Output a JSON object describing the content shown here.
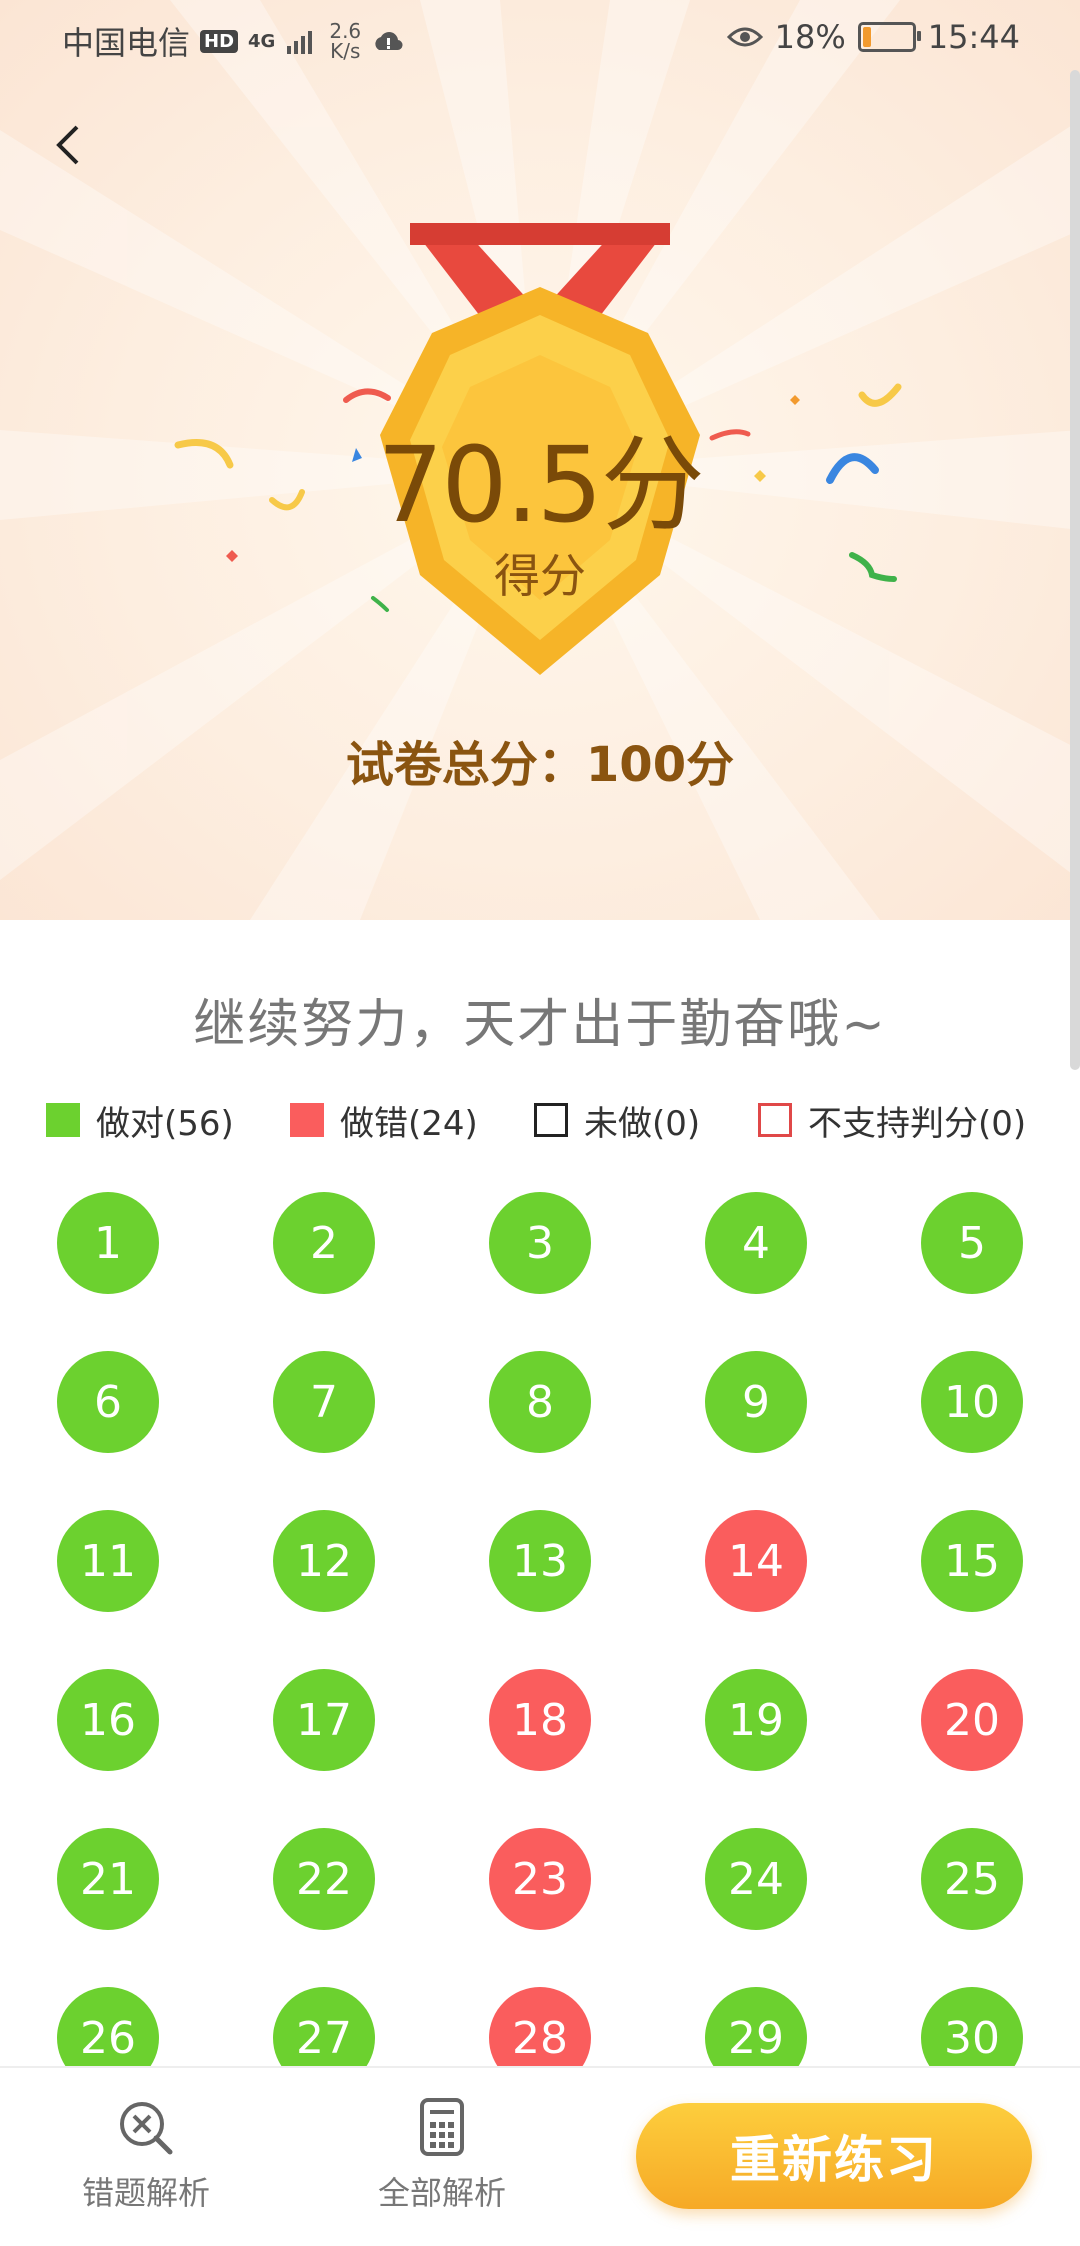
{
  "status_bar": {
    "carrier": "中国电信",
    "hd_badge": "HD",
    "network": "4G",
    "speed_value": "2.6",
    "speed_unit": "K/s",
    "battery_percent": "18%",
    "battery_level": 0.18,
    "time": "15:44"
  },
  "result": {
    "score": "70.5分",
    "score_label": "得分",
    "total": "试卷总分：100分",
    "motto": "继续努力，天才出于勤奋哦~"
  },
  "legend": {
    "correct": "做对(56)",
    "wrong": "做错(24)",
    "undone": "未做(0)",
    "unsupported": "不支持判分(0)"
  },
  "colors": {
    "correct": "#6cd12f",
    "wrong": "#fa5d5d",
    "accent": "#f6a926"
  },
  "questions": [
    {
      "n": "1",
      "s": "correct"
    },
    {
      "n": "2",
      "s": "correct"
    },
    {
      "n": "3",
      "s": "correct"
    },
    {
      "n": "4",
      "s": "correct"
    },
    {
      "n": "5",
      "s": "correct"
    },
    {
      "n": "6",
      "s": "correct"
    },
    {
      "n": "7",
      "s": "correct"
    },
    {
      "n": "8",
      "s": "correct"
    },
    {
      "n": "9",
      "s": "correct"
    },
    {
      "n": "10",
      "s": "correct"
    },
    {
      "n": "11",
      "s": "correct"
    },
    {
      "n": "12",
      "s": "correct"
    },
    {
      "n": "13",
      "s": "correct"
    },
    {
      "n": "14",
      "s": "wrong"
    },
    {
      "n": "15",
      "s": "correct"
    },
    {
      "n": "16",
      "s": "correct"
    },
    {
      "n": "17",
      "s": "correct"
    },
    {
      "n": "18",
      "s": "wrong"
    },
    {
      "n": "19",
      "s": "correct"
    },
    {
      "n": "20",
      "s": "wrong"
    },
    {
      "n": "21",
      "s": "correct"
    },
    {
      "n": "22",
      "s": "correct"
    },
    {
      "n": "23",
      "s": "wrong"
    },
    {
      "n": "24",
      "s": "correct"
    },
    {
      "n": "25",
      "s": "correct"
    },
    {
      "n": "26",
      "s": "correct"
    },
    {
      "n": "27",
      "s": "correct"
    },
    {
      "n": "28",
      "s": "wrong"
    },
    {
      "n": "29",
      "s": "correct"
    },
    {
      "n": "30",
      "s": "correct"
    }
  ],
  "bottom_bar": {
    "wrong_analysis": "错题解析",
    "all_analysis": "全部解析",
    "retry": "重新练习"
  }
}
